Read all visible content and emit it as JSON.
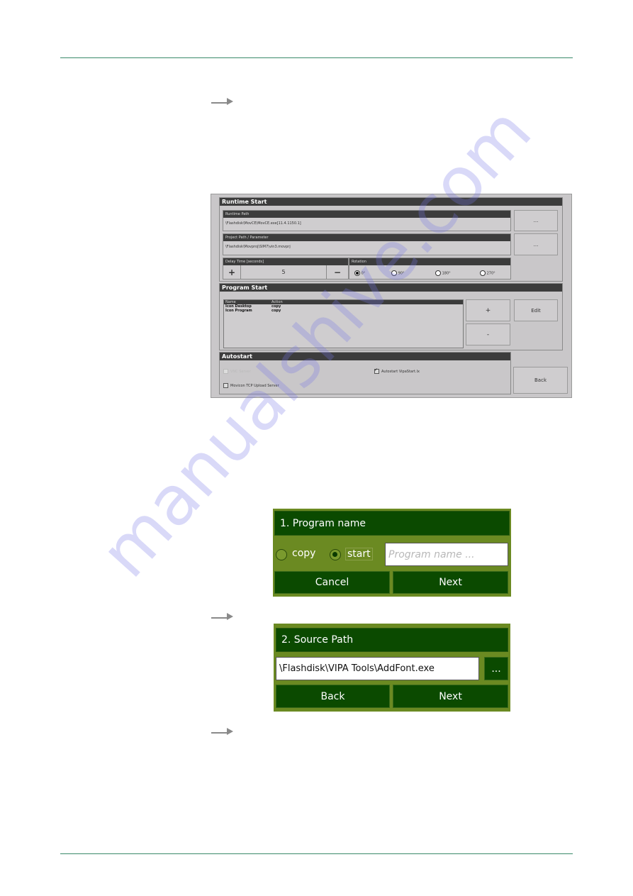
{
  "runtime_start": {
    "title": "Runtime Start",
    "runtime_path": {
      "label": "Runtime Path",
      "value": "\\Flashdisk\\MovCE\\MovCE.exe[11.4.1150.1]",
      "browse_label": "..."
    },
    "project_path": {
      "label": "Project Path / Parameter",
      "value": "\\Flashdisk\\Movproj\\SIM7\\vin3.movprj",
      "browse_label": "..."
    },
    "delay_time": {
      "label": "Delay Time [seconds]",
      "value": "5",
      "plus_label": "+",
      "minus_label": "−"
    },
    "rotation": {
      "label": "Rotation",
      "options": [
        "0°",
        "90°",
        "180°",
        "270°"
      ],
      "selected": "0°"
    }
  },
  "program_start": {
    "title": "Program Start",
    "columns": [
      "Name",
      "Action"
    ],
    "rows": [
      {
        "name": "Icon Desktop",
        "action": "copy"
      },
      {
        "name": "Icon Program",
        "action": "copy"
      }
    ],
    "add_label": "+",
    "remove_label": "-",
    "edit_label": "Edit"
  },
  "autostart": {
    "title": "Autostart",
    "options": [
      {
        "label": "VNC Server",
        "checked": false,
        "disabled": true
      },
      {
        "label": "Autostart VipaStart.lx",
        "checked": true,
        "disabled": false
      },
      {
        "label": "Movicon TCP Upload Server",
        "checked": false,
        "disabled": false
      }
    ],
    "back_label": "Back"
  },
  "dialog_program_name": {
    "title": "1. Program name",
    "radio_copy": "copy",
    "radio_start": "start",
    "selected": "start",
    "name_placeholder": "Program name ...",
    "cancel_label": "Cancel",
    "next_label": "Next"
  },
  "dialog_source_path": {
    "title": "2. Source Path",
    "path_value": "\\Flashdisk\\VIPA Tools\\AddFont.exe",
    "browse_label": "...",
    "back_label": "Back",
    "next_label": "Next"
  },
  "watermark": "manualshive.com",
  "colors": {
    "rule": "#3a8a6a",
    "dialog_bg": "#6b8a22",
    "dialog_dark": "#0b4a00",
    "panel_gray": "#c9c7c9",
    "header_dark": "#3c3c3c"
  }
}
